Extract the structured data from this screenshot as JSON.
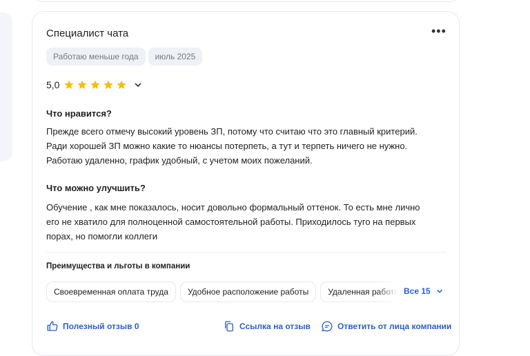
{
  "card": {
    "title": "Специалист чата",
    "chips": [
      "Работаю меньше года",
      "июль 2025"
    ],
    "rating": "5,0",
    "stars": 5,
    "likes_title": "Что нравится?",
    "likes_text": "Прежде всего отмечу высокий уровень ЗП, потому что считаю что это главный критерий.\nРади хорошей ЗП можно какие то нюансы потерпеть, а тут и терпеть ничего не нужно.\nРаботаю удаленно, график удобный, с учетом моих пожеланий.",
    "improve_title": "Что можно улучшить?",
    "improve_text": "Обучение , как мне показалось, носит довольно формальный оттенок. То есть мне лично\nего не хватило для полноценной самостоятельной работы. Приходилось туго на первых\nпорах, но помогли коллеги",
    "benefits_title": "Преимущества и льготы в компании",
    "benefits": [
      "Своевременная оплата труда",
      "Удобное расположение работы",
      "Удаленная работа"
    ],
    "all_label": "Все 15",
    "useful_label": "Полезный отзыв 0",
    "link_label": "Ссылка на отзыв",
    "reply_label": "Ответить от лица компании"
  },
  "colors": {
    "accent": "#2b5fc6",
    "star": "#f7bc0e",
    "chip_bg": "#eef1f6"
  },
  "icons": [
    "more-icon",
    "star-icon",
    "chevron-down-icon",
    "thumbs-up-icon",
    "copy-link-icon",
    "chat-icon"
  ]
}
